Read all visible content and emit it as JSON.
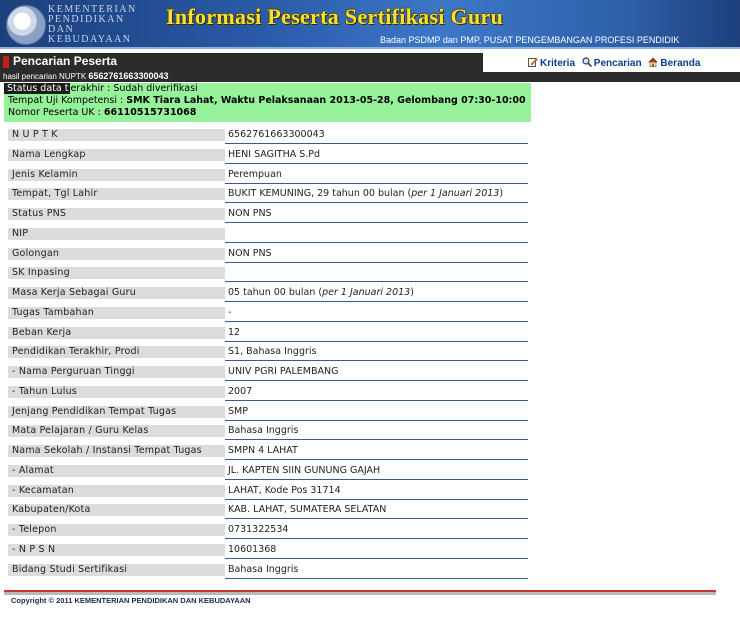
{
  "header": {
    "logo_lines": [
      "KEMENTERIAN",
      "PENDIDIKAN",
      "DAN",
      "KEBUDAYAAN"
    ],
    "title": "Informasi Peserta Sertifikasi Guru",
    "subtitle": "Badan PSDMP dan PMP, PUSAT PENGEMBANGAN PROFESI PENDIDIK"
  },
  "searchbar": {
    "title": "Pencarian Peserta",
    "links": [
      {
        "label": "Kriteria",
        "icon": "edit-icon"
      },
      {
        "label": "Pencarian",
        "icon": "magnifier-icon"
      },
      {
        "label": "Beranda",
        "icon": "home-icon"
      }
    ],
    "result_prefix": "hasil pencarian NUPTK",
    "result_value": "6562761663300043"
  },
  "status": {
    "line1_tag": "Status data t",
    "line1_rest": "erakhir : Sudah diverifikasi",
    "line2_label": "Tempat Uji Kompetensi : ",
    "line2_value": "SMK Tiara Lahat, Waktu Pelaksanaan 2013-05-28, Gelombang 07:30-10:00",
    "line3_label": "Nomor Peserta UK : ",
    "line3_value": "66110515731068"
  },
  "rows": [
    {
      "label": "N U P T K",
      "value": "6562761663300043"
    },
    {
      "label": "Nama Lengkap",
      "value": "HENI SAGITHA S.Pd"
    },
    {
      "label": "Jenis Kelamin",
      "value": "Perempuan"
    },
    {
      "label": "Tempat, Tgl Lahir",
      "value": "BUKIT KEMUNING, 29 tahun 00 bulan (",
      "italic": "per 1 Januari 2013",
      "suffix": ")"
    },
    {
      "label": "Status PNS",
      "value": "NON PNS"
    },
    {
      "label": "NIP",
      "value": ""
    },
    {
      "label": "Golongan",
      "value": "NON PNS"
    },
    {
      "label": "SK Inpasing",
      "value": ""
    },
    {
      "label": "Masa Kerja Sebagai Guru",
      "value": "05 tahun 00 bulan (",
      "italic": "per 1 Januari 2013",
      "suffix": ")"
    },
    {
      "label": "Tugas Tambahan",
      "value": "-"
    },
    {
      "label": "Beban Kerja",
      "value": "12"
    },
    {
      "label": "Pendidikan Terakhir, Prodi",
      "value": "S1, Bahasa Inggris"
    },
    {
      "label": "- Nama Perguruan Tinggi",
      "value": "UNIV PGRI PALEMBANG"
    },
    {
      "label": "- Tahun Lulus",
      "value": "2007"
    },
    {
      "label": "Jenjang Pendidikan Tempat Tugas",
      "value": "SMP"
    },
    {
      "label": "Mata Pelajaran / Guru Kelas",
      "value": "Bahasa Inggris"
    },
    {
      "label": "Nama Sekolah / Instansi Tempat Tugas",
      "value": "SMPN 4 LAHAT"
    },
    {
      "label": "- Alamat",
      "value": "JL. KAPTEN SIIN GUNUNG GAJAH"
    },
    {
      "label": "- Kecamatan",
      "value": "LAHAT, Kode Pos 31714"
    },
    {
      "label": "Kabupaten/Kota",
      "value": "KAB. LAHAT, SUMATERA SELATAN"
    },
    {
      "label": "- Telepon",
      "value": "0731322534"
    },
    {
      "label": "- N P S N",
      "value": "10601368"
    },
    {
      "label": "Bidang Studi Sertifikasi",
      "value": "Bahasa Inggris"
    }
  ],
  "footer": {
    "copyright": "Copyright © 2011 KEMENTERIAN PENDIDIKAN DAN KEBUDAYAAN"
  }
}
